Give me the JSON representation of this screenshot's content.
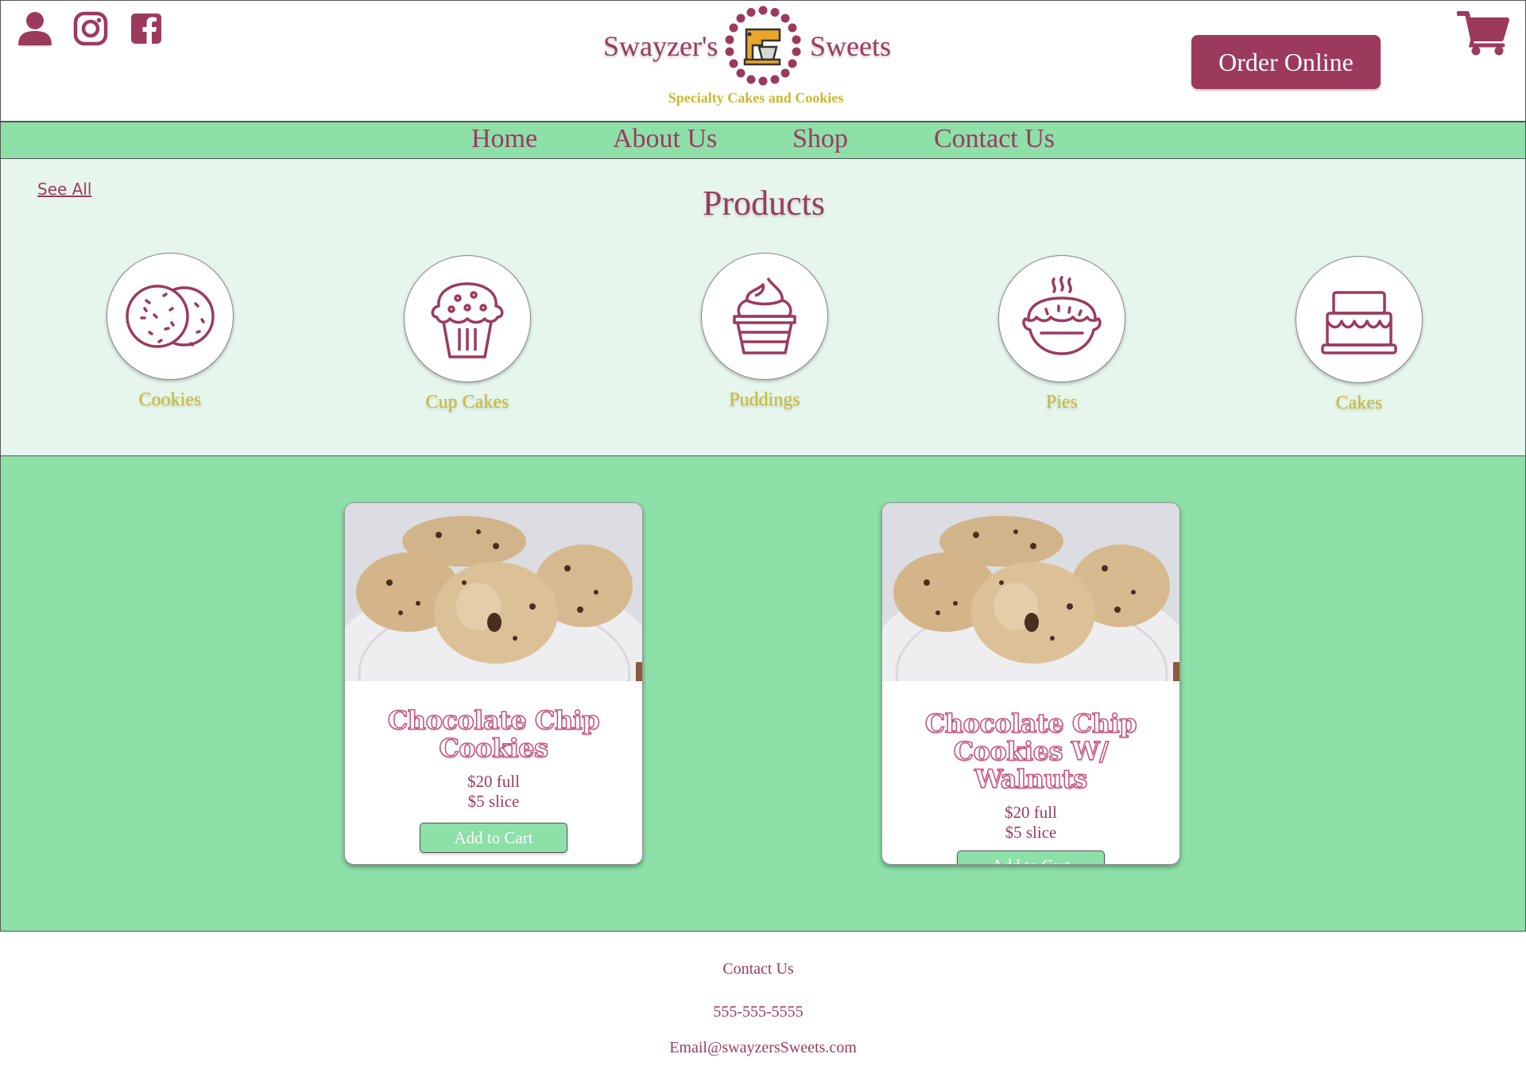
{
  "header": {
    "brand_left": "Swayzer's",
    "brand_right": "Sweets",
    "tagline": "Specialty Cakes and Cookies",
    "order_button": "Order Online",
    "social_icons": [
      "user-icon",
      "instagram-icon",
      "facebook-icon"
    ],
    "cart_icon": "cart-icon"
  },
  "nav": {
    "items": [
      {
        "label": "Home"
      },
      {
        "label": "About Us"
      },
      {
        "label": "Shop"
      },
      {
        "label": "Contact Us"
      }
    ]
  },
  "products": {
    "see_all": "See All",
    "title": "Products",
    "categories": [
      {
        "label": "Cookies",
        "icon": "cookies-icon"
      },
      {
        "label": "Cup Cakes",
        "icon": "cupcake-icon"
      },
      {
        "label": "Puddings",
        "icon": "pudding-icon"
      },
      {
        "label": "Pies",
        "icon": "pie-icon"
      },
      {
        "label": "Cakes",
        "icon": "cake-icon"
      }
    ]
  },
  "cards": [
    {
      "title": "Chocolate Chip Cookies",
      "price_full": "$20 full",
      "price_slice": "$5 slice",
      "button": "Add to Cart"
    },
    {
      "title": "Chocolate Chip Cookies W/ Walnuts",
      "price_full": "$20 full",
      "price_slice": "$5 slice",
      "button": "Add to Cart"
    }
  ],
  "footer": {
    "contact_label": "Contact Us",
    "phone": "555-555-5555",
    "email": "Email@swayzersSweets.com"
  },
  "colors": {
    "brand": "#9c3a5e",
    "accent_green": "#8ce0a8",
    "light_green": "#e6f6ec",
    "gold": "#c9b92c"
  }
}
